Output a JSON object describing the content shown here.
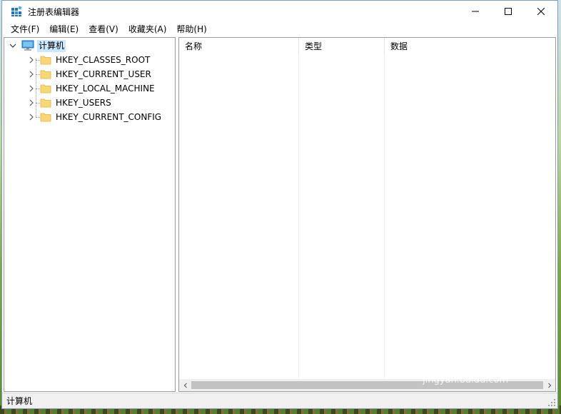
{
  "window": {
    "title": "注册表编辑器"
  },
  "menu": [
    {
      "label": "文件(F)"
    },
    {
      "label": "编辑(E)"
    },
    {
      "label": "查看(V)"
    },
    {
      "label": "收藏夹(A)"
    },
    {
      "label": "帮助(H)"
    }
  ],
  "tree": {
    "root": "计算机",
    "keys": [
      {
        "label": "HKEY_CLASSES_ROOT"
      },
      {
        "label": "HKEY_CURRENT_USER"
      },
      {
        "label": "HKEY_LOCAL_MACHINE"
      },
      {
        "label": "HKEY_USERS"
      },
      {
        "label": "HKEY_CURRENT_CONFIG"
      }
    ]
  },
  "list": {
    "columns": [
      {
        "label": "名称"
      },
      {
        "label": "类型"
      },
      {
        "label": "数据"
      }
    ]
  },
  "status": {
    "path": "计算机"
  },
  "watermark": {
    "logo": "Bai du 经验",
    "url": "jingyan.baidu.com"
  },
  "colors": {
    "selection": "#cce8ff",
    "folder": "#f5d77a",
    "accent": "#0078d7"
  }
}
